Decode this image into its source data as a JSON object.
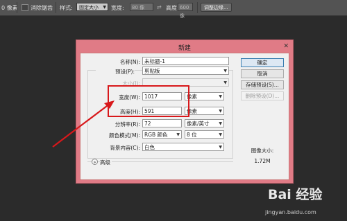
{
  "options_bar": {
    "feather_value": "0 像素",
    "antialias_label": "消除锯齿",
    "style_label": "样式:",
    "style_value": "固定大小",
    "width_label": "宽度:",
    "width_value": "80 像",
    "height_label": "高度:",
    "height_value": "600 像",
    "refine_edge_button": "调整边缘..."
  },
  "dialog": {
    "title": "新建",
    "close_glyph": "✕",
    "name_label": "名称(N):",
    "name_value": "未标题-1",
    "preset_label": "预设(P):",
    "preset_value": "剪贴板",
    "size_label": "大小(I):",
    "width_label": "宽度(W):",
    "width_value": "1017",
    "width_unit": "像素",
    "height_label": "高度(H):",
    "height_value": "591",
    "height_unit": "像素",
    "resolution_label": "分辨率(R):",
    "resolution_value": "72",
    "resolution_unit": "像素/英寸",
    "color_mode_label": "颜色模式(M):",
    "color_mode_value": "RGB 颜色",
    "bit_depth_value": "8 位",
    "background_label": "背景内容(C):",
    "background_value": "白色",
    "advanced_label": "高级",
    "buttons": {
      "ok": "确定",
      "cancel": "取消",
      "save_preset": "存储预设(S)...",
      "delete_preset": "删除预设(D)..."
    },
    "image_size_label": "图像大小:",
    "image_size_value": "1.72M"
  },
  "watermark": {
    "logo_text": "Bai 经验",
    "url": "jingyan.baidu.com"
  },
  "colors": {
    "annotation_red": "#d8181b",
    "dialog_frame": "#e07b86"
  }
}
